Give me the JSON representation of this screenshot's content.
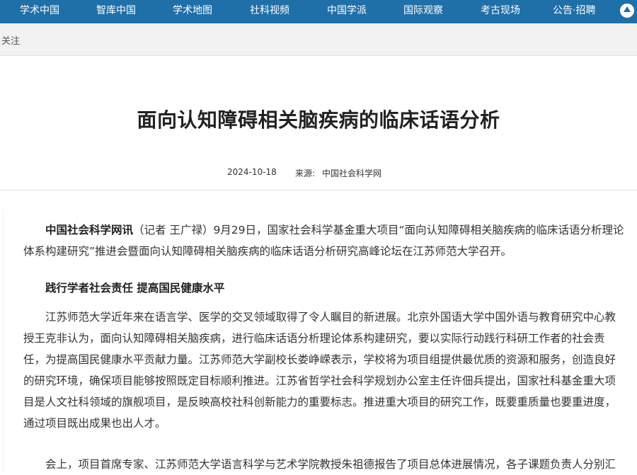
{
  "topnav": {
    "items": [
      "学术中国",
      "智库中国",
      "学术地图",
      "社科视频",
      "中国学派",
      "国际观察",
      "考古现场",
      "公告·招聘"
    ]
  },
  "breadcrumb": {
    "text": "关注"
  },
  "article": {
    "title": "面向认知障碍相关脑疾病的临床话语分析",
    "date": "2024-10-18",
    "source_label": "来源:",
    "source": "中国社会科学网",
    "p1_lead": "中国社会科学网讯",
    "p1_text": "（记者 王广禄）9月29日，国家社会科学基金重大项目“面向认知障碍相关脑疾病的临床话语分析理论体系构建研究”推进会暨面向认知障碍相关脑疾病的临床话语分析研究高峰论坛在江苏师范大学召开。",
    "subhead": "践行学者社会责任 提高国民健康水平",
    "p2_text": "江苏师范大学近年来在语言学、医学的交叉领域取得了令人瞩目的新进展。北京外国语大学中国外语与教育研究中心教授王克非认为，面向认知障碍相关脑疾病，进行临床话语分析理论体系构建研究，要以实际行动践行科研工作者的社会责任，为提高国民健康水平贡献力量。江苏师范大学副校长娄峥嵘表示，学校将为项目组提供最优质的资源和服务，创造良好的研究环境，确保项目能够按照既定目标顺利推进。江苏省哲学社会科学规划办公室主任许佃兵提出，国家社科基金重大项目是人文社科领域的旗舰项目，是反映高校社科创新能力的重要标志。推进重大项目的研究工作，既要重质量也要重进度，通过项目既出成果也出人才。",
    "p3_text": "会上，项目首席专家、江苏师范大学语言科学与艺术学院教授朱祖德报告了项目总体进展情况，各子课题负责人分别汇"
  },
  "colors": {
    "nav_bg": "#1f6fa8",
    "crumb_bg": "#f2f2f2"
  },
  "icons": {
    "scroll_top": "arrow-up-icon"
  }
}
